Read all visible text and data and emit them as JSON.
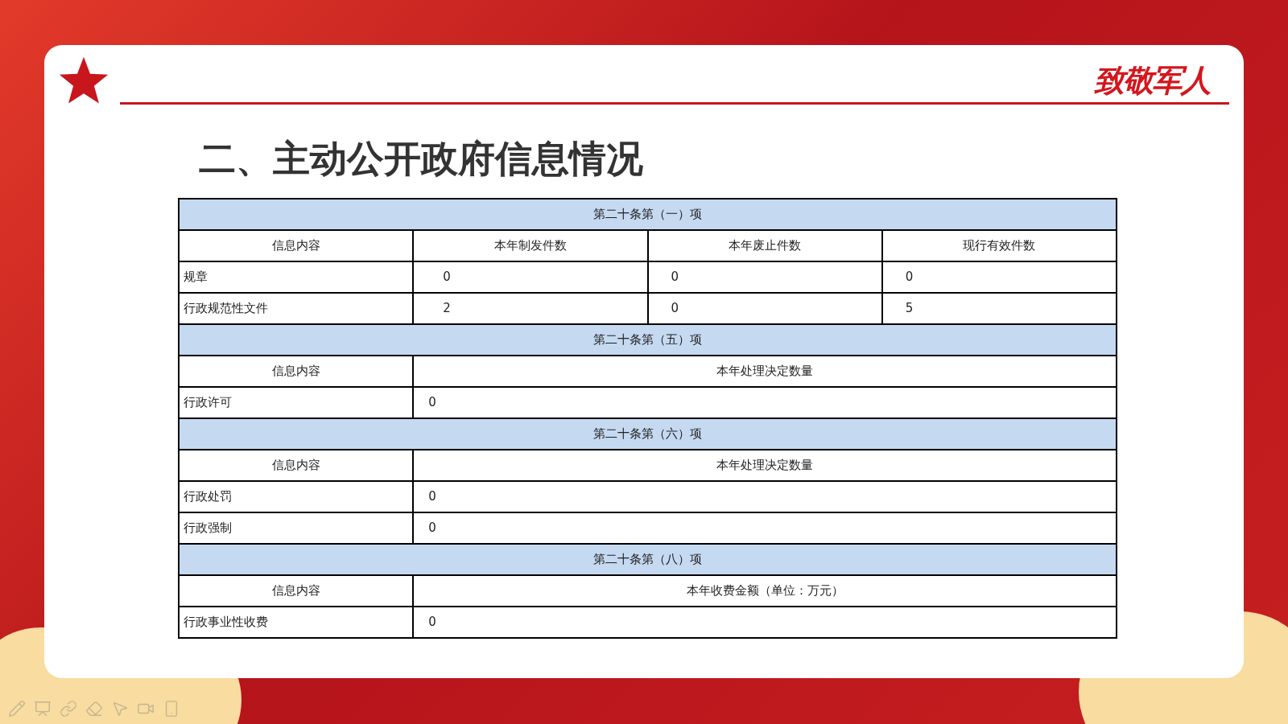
{
  "title": "二、主动公开政府信息情况",
  "logo": {
    "text": "致敬军人"
  },
  "sections": [
    {
      "title": "第二十条第（一）项",
      "columns": [
        "信息内容",
        "本年制发件数",
        "本年废止件数",
        "现行有效件数"
      ],
      "rows": [
        [
          "规章",
          "0",
          "0",
          "0"
        ],
        [
          "行政规范性文件",
          "2",
          "0",
          "5"
        ]
      ]
    },
    {
      "title": "第二十条第（五）项",
      "columns": [
        "信息内容",
        "本年处理决定数量"
      ],
      "rows": [
        [
          "行政许可",
          "0"
        ]
      ]
    },
    {
      "title": "第二十条第（六）项",
      "columns": [
        "信息内容",
        "本年处理决定数量"
      ],
      "rows": [
        [
          "行政处罚",
          "0"
        ],
        [
          "行政强制",
          "0"
        ]
      ]
    },
    {
      "title": "第二十条第（八）项",
      "columns": [
        "信息内容",
        "本年收费金额（单位：万元）"
      ],
      "rows": [
        [
          "行政事业性收费",
          "0"
        ]
      ]
    }
  ]
}
